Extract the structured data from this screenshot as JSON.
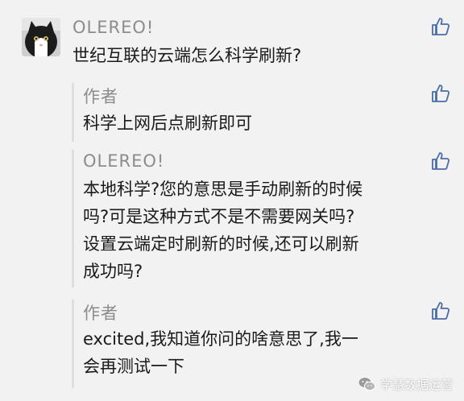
{
  "comments": [
    {
      "author": "OLEREO!",
      "text_lines": [
        "世纪互联的云端怎么科学刷新?"
      ]
    }
  ],
  "replies": [
    {
      "author": "作者",
      "text_lines": [
        "科学上网后点刷新即可"
      ]
    },
    {
      "author": "OLEREO!",
      "text_lines": [
        "本地科学?您的意思是手动刷新的时候",
        "吗?可是这种方式不是不需要网关吗?",
        "设置云端定时刷新的时候,还可以刷新",
        "成功吗?"
      ]
    },
    {
      "author": "作者",
      "text_lines": [
        "excited,我知道你问的啥意思了,我一",
        "会再测试一下"
      ]
    }
  ],
  "icons": {
    "like": "thumbs-up-icon",
    "avatar": "cat-avatar",
    "watermark": "wechat-icon"
  },
  "watermark": {
    "text": "学慧数据运营"
  },
  "colors": {
    "background": "#f2f2f2",
    "name": "#8c8c8c",
    "text": "#1a1a1a",
    "like_icon": "#4a6da7",
    "reply_bar": "#dedede"
  }
}
